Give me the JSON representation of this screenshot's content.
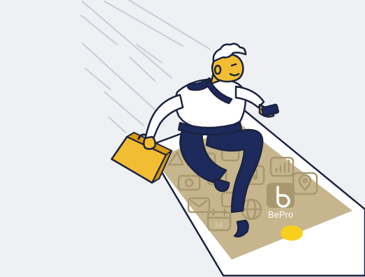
{
  "scene": {
    "colors": {
      "background": "#eef0f4",
      "navy": "#1d2a5b",
      "mustard": "#f2bd32",
      "screen": "#c6b58d",
      "icon": "#a9986f",
      "phone_frame": "#ffffff",
      "home_button": "#f8cf1e",
      "outline": "#1b2340"
    },
    "phone": {
      "brand_label": "BePro",
      "calendar_day": "16"
    }
  }
}
